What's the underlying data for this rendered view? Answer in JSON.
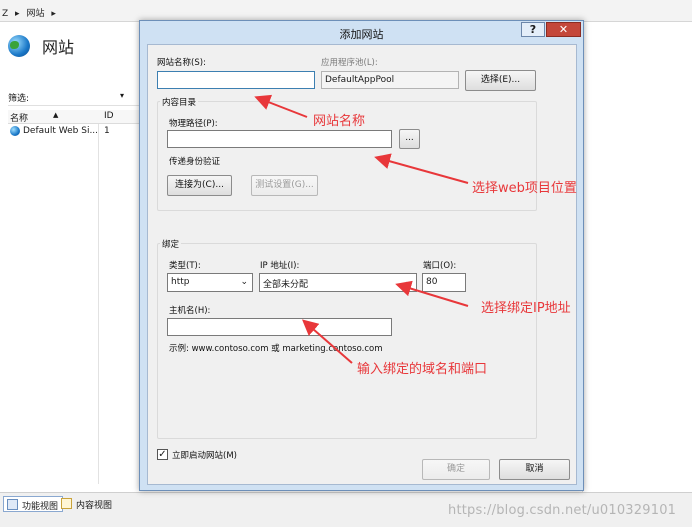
{
  "breadcrumb": {
    "items": [
      "Z",
      "网站"
    ],
    "separator": "▸"
  },
  "left_panel": {
    "title": "网站",
    "filter_label": "筛选:",
    "filter_dropdown": "▾",
    "columns": [
      "名称",
      "ID"
    ],
    "sort_indicator": "▲",
    "rows": [
      {
        "name": "Default Web Si...",
        "id": "1"
      }
    ]
  },
  "bottom_tabs": {
    "features_view": "功能视图",
    "content_view": "内容视图"
  },
  "watermark": "https://blog.csdn.net/u010329101",
  "dialog": {
    "title": "添加网站",
    "help_glyph": "?",
    "close_glyph": "✕",
    "site_name_label": "网站名称(S):",
    "site_name_value": "",
    "app_pool_label": "应用程序池(L):",
    "app_pool_value": "DefaultAppPool",
    "select_button": "选择(E)...",
    "content_dir_title": "内容目录",
    "physical_path_label": "物理路径(P):",
    "physical_path_value": "",
    "browse_button": "...",
    "pass_auth_label": "传递身份验证",
    "connect_as_button": "连接为(C)...",
    "test_settings_button": "测试设置(G)...",
    "binding_title": "绑定",
    "type_label": "类型(T):",
    "type_value": "http",
    "ip_label": "IP 地址(I):",
    "ip_value": "全部未分配",
    "port_label": "端口(O):",
    "port_value": "80",
    "host_label": "主机名(H):",
    "host_value": "",
    "example_text": "示例: www.contoso.com 或 marketing.contoso.com",
    "start_now_label": "立即启动网站(M)",
    "start_now_checked": true,
    "ok_button": "确定",
    "cancel_button": "取消"
  },
  "annotations": {
    "site_name": "网站名称",
    "web_location": "选择web项目位置",
    "bind_ip": "选择绑定IP地址",
    "domain_port": "输入绑定的域名和端口"
  },
  "colors": {
    "annotation": "#e8373a",
    "dialog_frame": "#cfe1f3",
    "close_button": "#c4473a"
  }
}
